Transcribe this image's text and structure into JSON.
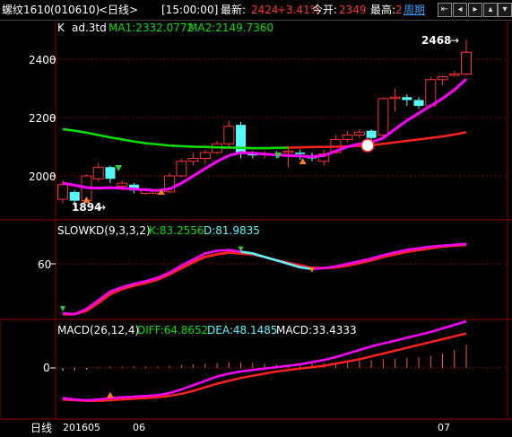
{
  "header": {
    "symbol": "螺纹1610",
    "code": "(010610)",
    "period": "<日线>",
    "time": "[15:00:00]",
    "latest_label": "最新:",
    "latest_value": "2424",
    "change_pct": "+3.41%",
    "open_label": "今开:",
    "open_value": "2349",
    "high_label": "最高:",
    "high_value": "2",
    "link": "周期"
  },
  "nav_icons": [
    "collapse-left-icon",
    "arrow-left-icon",
    "arrow-right-icon",
    "zoom-in-icon",
    "zoom-out-icon"
  ],
  "main_panel": {
    "k_label": "K",
    "adjust_label": "ad.3td",
    "ma1_text": "MA1:2332.0772",
    "ma2_text": "MA2:2149.7360",
    "yticks": [
      "2400",
      "2200",
      "2000"
    ],
    "high_marker": "2468",
    "low_marker": "1894"
  },
  "kd_panel": {
    "title": "SLOWKD(9,3,3,2)",
    "k_text": "K:83.2556",
    "d_text": "D:81.9835",
    "ytick": "60"
  },
  "macd_panel": {
    "title": "MACD(26,12,4)",
    "diff_text": "DIFF:64.8652",
    "dea_text": "DEA:48.1485",
    "macd_text": "MACD:33.4333",
    "ytick": "0"
  },
  "footer": {
    "period_label": "日线",
    "xticks": [
      "201605",
      "06",
      "07"
    ]
  },
  "colors": {
    "up": "#ff3232",
    "down": "#54fcfc",
    "ma1": "#ff00ff",
    "ma2": "#00e000",
    "dea": "#ff2020",
    "grid": "#8b0000",
    "text": "#ffffff",
    "yellow": "#ffff00"
  },
  "chart_data": {
    "type": "candlestick",
    "xticks": [
      "201605",
      "06",
      "07"
    ],
    "ylim": [
      1880,
      2480
    ],
    "candles": [
      {
        "o": 1920,
        "c": 1970,
        "h": 1985,
        "l": 1905
      },
      {
        "o": 1945,
        "c": 1915,
        "h": 1950,
        "l": 1894
      },
      {
        "o": 1915,
        "c": 2000,
        "h": 2005,
        "l": 1910
      },
      {
        "o": 1990,
        "c": 2030,
        "h": 2045,
        "l": 1980
      },
      {
        "o": 2030,
        "c": 1990,
        "h": 2035,
        "l": 1975
      },
      {
        "o": 1965,
        "c": 1975,
        "h": 1985,
        "l": 1950
      },
      {
        "o": 1970,
        "c": 1950,
        "h": 1975,
        "l": 1940
      },
      {
        "o": 1940,
        "c": 1955,
        "h": 1960,
        "l": 1935
      },
      {
        "o": 1940,
        "c": 1950,
        "h": 1955,
        "l": 1935
      },
      {
        "o": 1945,
        "c": 2000,
        "h": 2010,
        "l": 1940
      },
      {
        "o": 2000,
        "c": 2050,
        "h": 2060,
        "l": 1995
      },
      {
        "o": 2050,
        "c": 2060,
        "h": 2080,
        "l": 2035
      },
      {
        "o": 2060,
        "c": 2080,
        "h": 2090,
        "l": 2040
      },
      {
        "o": 2080,
        "c": 2110,
        "h": 2120,
        "l": 2075
      },
      {
        "o": 2110,
        "c": 2170,
        "h": 2190,
        "l": 2100
      },
      {
        "o": 2175,
        "c": 2075,
        "h": 2185,
        "l": 2060
      },
      {
        "o": 2075,
        "c": 2070,
        "h": 2085,
        "l": 2060
      },
      {
        "o": 2075,
        "c": 2075,
        "h": 2085,
        "l": 2060
      },
      {
        "o": 2075,
        "c": 2070,
        "h": 2085,
        "l": 2060
      },
      {
        "o": 2080,
        "c": 2085,
        "h": 2100,
        "l": 2030
      },
      {
        "o": 2080,
        "c": 2075,
        "h": 2090,
        "l": 2055
      },
      {
        "o": 2070,
        "c": 2060,
        "h": 2080,
        "l": 2050
      },
      {
        "o": 2050,
        "c": 2075,
        "h": 2090,
        "l": 2035
      },
      {
        "o": 2080,
        "c": 2125,
        "h": 2140,
        "l": 2075
      },
      {
        "o": 2125,
        "c": 2140,
        "h": 2155,
        "l": 2115
      },
      {
        "o": 2140,
        "c": 2150,
        "h": 2160,
        "l": 2130
      },
      {
        "o": 2155,
        "c": 2130,
        "h": 2160,
        "l": 2115
      },
      {
        "o": 2140,
        "c": 2265,
        "h": 2270,
        "l": 2130
      },
      {
        "o": 2265,
        "c": 2270,
        "h": 2300,
        "l": 2220
      },
      {
        "o": 2270,
        "c": 2260,
        "h": 2280,
        "l": 2240
      },
      {
        "o": 2260,
        "c": 2240,
        "h": 2270,
        "l": 2230
      },
      {
        "o": 2240,
        "c": 2330,
        "h": 2340,
        "l": 2235
      },
      {
        "o": 2330,
        "c": 2340,
        "h": 2345,
        "l": 2310
      },
      {
        "o": 2345,
        "c": 2350,
        "h": 2360,
        "l": 2340
      },
      {
        "o": 2349,
        "c": 2424,
        "h": 2468,
        "l": 2345
      }
    ],
    "ma1": [
      1975,
      1968,
      1960,
      1958,
      1960,
      1958,
      1955,
      1952,
      1950,
      1955,
      1975,
      2000,
      2025,
      2050,
      2070,
      2080,
      2078,
      2075,
      2072,
      2070,
      2068,
      2066,
      2070,
      2085,
      2100,
      2110,
      2115,
      2130,
      2160,
      2190,
      2215,
      2240,
      2265,
      2295,
      2332
    ],
    "ma2": [
      2160,
      2155,
      2148,
      2140,
      2132,
      2125,
      2118,
      2112,
      2108,
      2104,
      2102,
      2100,
      2099,
      2098,
      2097,
      2096,
      2095,
      2095,
      2096,
      2097,
      2098,
      2099,
      2099,
      2100,
      2101,
      2103,
      2105,
      2110,
      2115,
      2120,
      2125,
      2130,
      2135,
      2142,
      2150
    ],
    "kd": {
      "k": [
        3,
        2,
        8,
        18,
        28,
        33,
        37,
        40,
        44,
        50,
        58,
        65,
        72,
        75,
        76,
        74,
        72,
        68,
        64,
        60,
        56,
        54,
        55,
        57,
        60,
        63,
        66,
        70,
        73,
        76,
        78,
        80,
        81,
        82,
        83
      ],
      "d": [
        2,
        2,
        6,
        15,
        25,
        31,
        35,
        38,
        42,
        48,
        55,
        62,
        68,
        71,
        73,
        72,
        71,
        68,
        64,
        61,
        58,
        55,
        55,
        56,
        58,
        61,
        64,
        68,
        71,
        74,
        76,
        78,
        80,
        81,
        82
      ]
    },
    "macd": {
      "diff": [
        -42,
        -44,
        -45,
        -44,
        -42,
        -41,
        -40,
        -39,
        -38,
        -35,
        -30,
        -24,
        -18,
        -12,
        -8,
        -5,
        -3,
        -1,
        1,
        3,
        5,
        8,
        11,
        15,
        20,
        25,
        30,
        34,
        38,
        42,
        46,
        50,
        55,
        60,
        65
      ],
      "dea": [
        -44,
        -45,
        -46,
        -46,
        -45,
        -44,
        -43,
        -42,
        -41,
        -39,
        -36,
        -32,
        -27,
        -22,
        -18,
        -14,
        -11,
        -8,
        -5,
        -3,
        -1,
        1,
        3,
        6,
        9,
        12,
        16,
        20,
        24,
        28,
        32,
        36,
        40,
        44,
        48
      ],
      "hist": [
        -4,
        -3,
        -2,
        1,
        2,
        2,
        2,
        2,
        2,
        3,
        4,
        5,
        6,
        7,
        8,
        8,
        7,
        6,
        5,
        5,
        5,
        6,
        7,
        8,
        9,
        10,
        11,
        12,
        13,
        14,
        15,
        17,
        20,
        25,
        33
      ]
    }
  }
}
